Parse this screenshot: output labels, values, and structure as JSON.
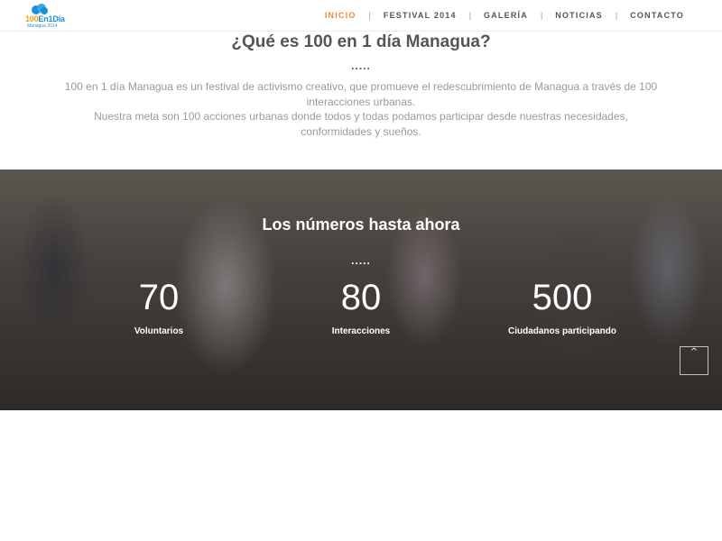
{
  "brand": {
    "logo_text_a": "100",
    "logo_text_b": "En1Día",
    "logo_tagline": "Managua 2014"
  },
  "nav": {
    "items": [
      {
        "label": "INICIO",
        "active": true
      },
      {
        "label": "FESTIVAL 2014",
        "active": false
      },
      {
        "label": "GALERÍA",
        "active": false
      },
      {
        "label": "NOTICIAS",
        "active": false
      },
      {
        "label": "CONTACTO",
        "active": false
      }
    ],
    "separator": "|"
  },
  "intro": {
    "title": "¿Qué es 100 en 1 día Managua?",
    "divider": ".....",
    "line1": "100 en 1 día Managua es un festival de activismo creativo, que promueve el redescubrimiento de Managua a través de 100 interacciones urbanas.",
    "line2": "Nuestra meta son 100 acciones urbanas donde todos y todas podamos participar desde nuestras necesidades, conformidades y sueños."
  },
  "stats": {
    "title": "Los números hasta ahora",
    "divider": ".....",
    "items": [
      {
        "value": "70",
        "label": "Voluntarios"
      },
      {
        "value": "80",
        "label": "Interacciones"
      },
      {
        "value": "500",
        "label": "Ciudadanos participando"
      }
    ],
    "back_to_top_icon": "chevron-up-icon"
  },
  "colors": {
    "accent": "#f08a3a",
    "nav_text": "#555555",
    "body_text": "#9a9a9a"
  }
}
